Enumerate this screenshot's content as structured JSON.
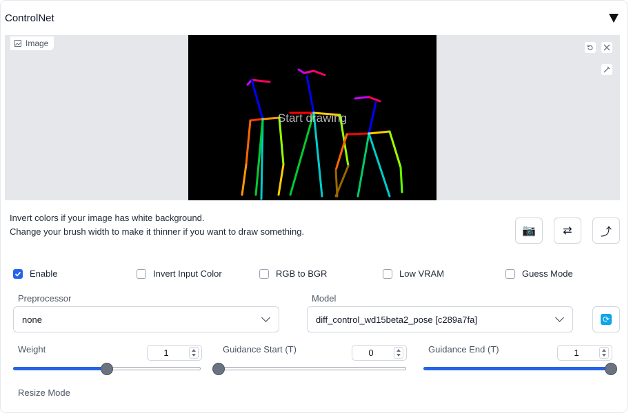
{
  "panel": {
    "title": "ControlNet"
  },
  "image": {
    "label": "Image",
    "overlay_text": "Start drawing"
  },
  "hints": [
    "Invert colors if your image has white background.",
    "Change your brush width to make it thinner if you want to draw something."
  ],
  "action_buttons": {
    "camera": "📷",
    "swap": "⇄",
    "curve": "⤴"
  },
  "checkboxes": [
    {
      "label": "Enable",
      "checked": true
    },
    {
      "label": "Invert Input Color",
      "checked": false
    },
    {
      "label": "RGB to BGR",
      "checked": false
    },
    {
      "label": "Low VRAM",
      "checked": false
    },
    {
      "label": "Guess Mode",
      "checked": false
    }
  ],
  "preprocessor": {
    "label": "Preprocessor",
    "value": "none"
  },
  "model": {
    "label": "Model",
    "value": "diff_control_wd15beta2_pose [c289a7fa]"
  },
  "sliders": [
    {
      "label": "Weight",
      "value": "1",
      "min": 0,
      "max": 2,
      "fraction": 0.5
    },
    {
      "label": "Guidance Start (T)",
      "value": "0",
      "min": 0,
      "max": 1,
      "fraction": 0.0
    },
    {
      "label": "Guidance End (T)",
      "value": "1",
      "min": 0,
      "max": 1,
      "fraction": 1.0
    }
  ],
  "resize_mode": {
    "label": "Resize Mode"
  },
  "colors": {
    "accent": "#2563eb",
    "canvas_bg": "#000000",
    "image_area_bg": "#e5e7eb"
  }
}
